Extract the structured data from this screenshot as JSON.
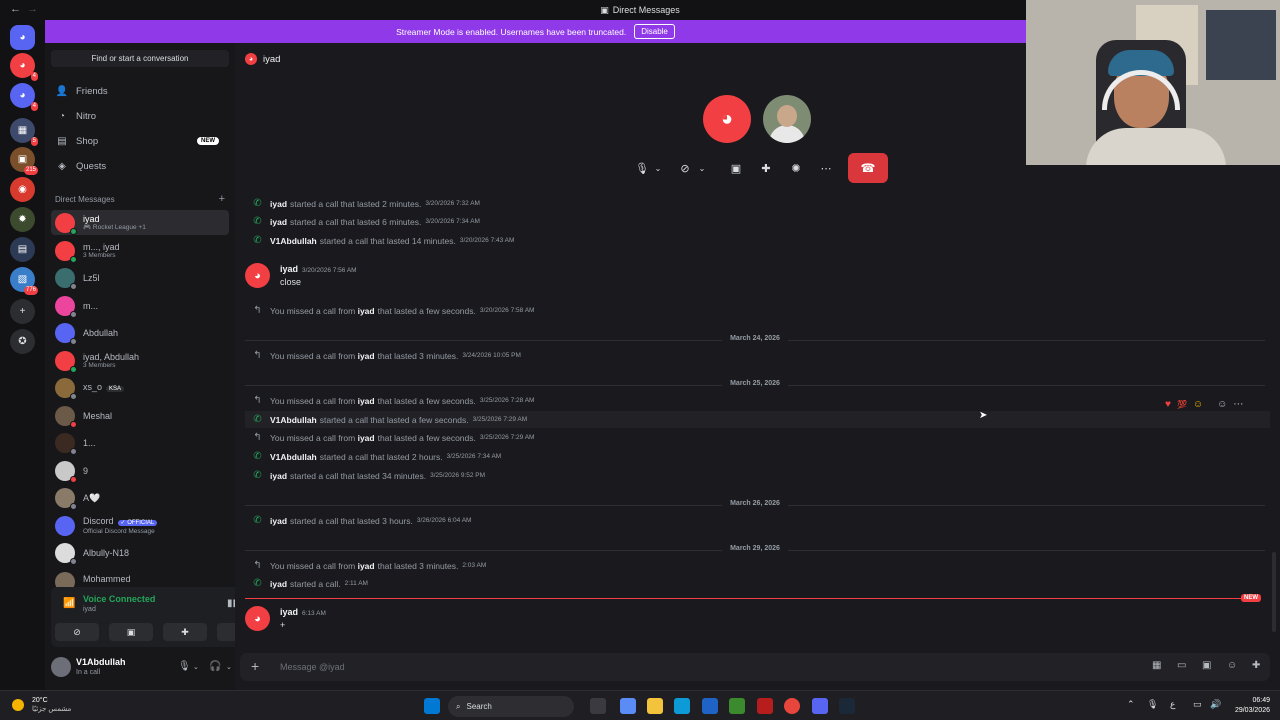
{
  "window": {
    "title": "Direct Messages"
  },
  "banner": {
    "text": "Streamer Mode is enabled. Usernames have been truncated.",
    "button": "Disable"
  },
  "rail": {
    "badges": [
      "4",
      "4",
      "5",
      "215",
      "776"
    ]
  },
  "sidebar": {
    "find_placeholder": "Find or start a conversation",
    "nav": [
      {
        "label": "Friends",
        "icon": "friends-icon"
      },
      {
        "label": "Nitro",
        "icon": "nitro-icon"
      },
      {
        "label": "Shop",
        "icon": "shop-icon",
        "badge": "NEW"
      },
      {
        "label": "Quests",
        "icon": "quests-icon"
      }
    ],
    "dm_header": "Direct Messages",
    "dm_add": "+",
    "dms": [
      {
        "name": "iyad",
        "sub": "🎮 Rocket League +1"
      },
      {
        "name": "m..., iyad",
        "sub": "3 Members"
      },
      {
        "name": "Lz5l",
        "sub": ""
      },
      {
        "name": "m...",
        "sub": ""
      },
      {
        "name": "Abdullah",
        "sub": ""
      },
      {
        "name": "iyad, Abdullah",
        "sub": "3 Members"
      },
      {
        "name": "xs_o",
        "sub": "",
        "tag": "KSA"
      },
      {
        "name": "Meshal",
        "sub": ""
      },
      {
        "name": "1...",
        "sub": ""
      },
      {
        "name": "9",
        "sub": ""
      },
      {
        "name": "A🤍",
        "sub": ""
      },
      {
        "name": "Discord",
        "sub": "Official Discord Message",
        "tag": "✓ OFFICIAL"
      },
      {
        "name": "Albully-N18",
        "sub": ""
      },
      {
        "name": "Mohammed",
        "sub": ""
      }
    ],
    "voice": {
      "status": "Voice Connected",
      "channel": "iyad"
    },
    "user": {
      "name": "V1Abdullah",
      "status": "In a call"
    }
  },
  "channel": {
    "name": "iyad"
  },
  "call_log": [
    {
      "icon": "green",
      "name": "iyad",
      "text": "started a call that lasted 2 minutes.",
      "ts": "3/20/2026 7:32 AM"
    },
    {
      "icon": "green",
      "name": "iyad",
      "text": "started a call that lasted 6 minutes.",
      "ts": "3/20/2026 7:34 AM"
    },
    {
      "icon": "green",
      "name": "V1Abdullah",
      "text": "started a call that lasted 14 minutes.",
      "ts": "3/20/2026 7:43 AM"
    }
  ],
  "message1": {
    "name": "iyad",
    "ts": "3/20/2026 7:56 AM",
    "text": "close"
  },
  "missed1": {
    "pre": "You missed a call from",
    "name": "iyad",
    "post": "that lasted a few seconds.",
    "ts": "3/20/2026 7:58 AM"
  },
  "date1": "March 24, 2026",
  "missed2": {
    "pre": "You missed a call from",
    "name": "iyad",
    "post": "that lasted 3 minutes.",
    "ts": "3/24/2026 10:05 PM"
  },
  "date2": "March 25, 2026",
  "block25": [
    {
      "type": "missed",
      "pre": "You missed a call from",
      "name": "iyad",
      "post": "that lasted a few seconds.",
      "ts": "3/25/2026 7:28 AM"
    },
    {
      "type": "started",
      "name": "V1Abdullah",
      "post": "started a call that lasted a few seconds.",
      "ts": "3/25/2026 7:29 AM"
    },
    {
      "type": "missed",
      "pre": "You missed a call from",
      "name": "iyad",
      "post": "that lasted a few seconds.",
      "ts": "3/25/2026 7:29 AM"
    },
    {
      "type": "started",
      "name": "V1Abdullah",
      "post": "started a call that lasted 2 hours.",
      "ts": "3/25/2026 7:34 AM"
    },
    {
      "type": "started",
      "name": "iyad",
      "post": "started a call that lasted 34 minutes.",
      "ts": "3/25/2026 9:52 PM"
    }
  ],
  "date3": "March 26, 2026",
  "block26": {
    "name": "iyad",
    "post": "started a call that lasted 3 hours.",
    "ts": "3/26/2026 6:04 AM"
  },
  "date4": "March 29, 2026",
  "block29": [
    {
      "type": "missed",
      "pre": "You missed a call from",
      "name": "iyad",
      "post": "that lasted 3 minutes.",
      "ts": "2:03 AM"
    },
    {
      "type": "started",
      "name": "iyad",
      "post": "started a call.",
      "ts": "2:11 AM"
    }
  ],
  "new_badge": "NEW",
  "message2": {
    "name": "iyad",
    "ts": "6:13 AM",
    "text": "+"
  },
  "composer": {
    "placeholder": "Message @iyad"
  },
  "taskbar": {
    "weather_temp": "20°C",
    "weather_label": "مشمس جزئيًا",
    "search": "Search",
    "time": "06:49",
    "date": "29/03/2026",
    "lang": "ع"
  },
  "colors": {
    "accent": "#5865f2",
    "banner": "#8f39e8",
    "danger": "#f23f43",
    "online": "#23a55a"
  }
}
